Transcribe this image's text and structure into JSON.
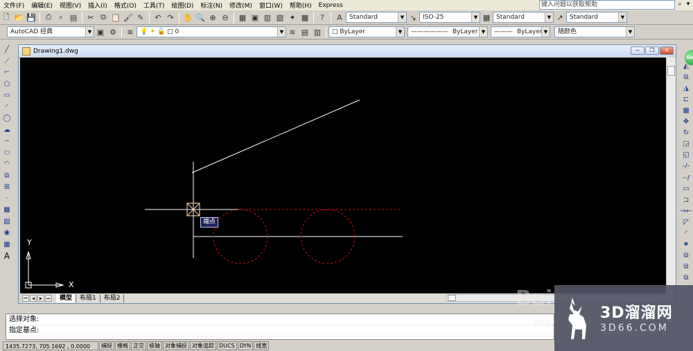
{
  "menu": {
    "items": [
      "文件(F)",
      "编辑(E)",
      "视图(V)",
      "插入(I)",
      "格式(O)",
      "工具(T)",
      "绘图(D)",
      "标注(N)",
      "修改(M)",
      "窗口(W)",
      "帮助(H)",
      "Express"
    ],
    "help_search_placeholder": "键入问题以获取帮助"
  },
  "toolbar1": {
    "text_style": "Standard",
    "dim_style": "ISO-25",
    "table_style": "Standard",
    "multileader_style": "Standard"
  },
  "toolbar2": {
    "workspace": "AutoCAD 经典",
    "layer": "0",
    "color": "ByLayer",
    "linetype": "ByLayer",
    "lineweight": "ByLayer",
    "plot_style": "随颜色"
  },
  "drawing": {
    "title": "Drawing1.dwg",
    "tooltip": "端点",
    "ucs_x": "X",
    "ucs_y": "Y",
    "tabs": [
      "模型",
      "布局1",
      "布局2"
    ]
  },
  "command": {
    "line1": "选择对象:",
    "line2": "指定基点:"
  },
  "status": {
    "coords": "1435.7273, 705.1692 , 0.0000",
    "buttons": [
      "捕捉",
      "栅格",
      "正交",
      "极轴",
      "对象捕捉",
      "对象追踪",
      "DUCS",
      "DYN",
      "线宽"
    ]
  },
  "watermark": {
    "brand": "3D溜溜网",
    "site": "3D66.COM"
  },
  "colors": {
    "canvas_bg": "#000000",
    "line_white": "#ffffff",
    "dashed_red": "#d01010",
    "cursor": "#e8c39a"
  }
}
